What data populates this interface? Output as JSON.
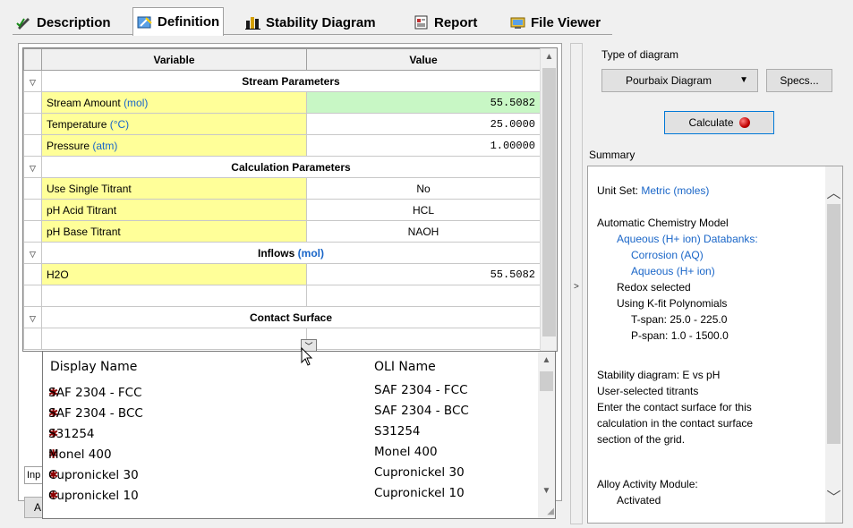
{
  "tabs": [
    {
      "label": "Description",
      "icon": "pencil-check-icon"
    },
    {
      "label": "Definition",
      "icon": "definition-icon"
    },
    {
      "label": "Stability Diagram",
      "icon": "bar-chart-icon"
    },
    {
      "label": "Report",
      "icon": "report-icon"
    },
    {
      "label": "File Viewer",
      "icon": "file-viewer-icon"
    }
  ],
  "grid": {
    "col_variable": "Variable",
    "col_value": "Value",
    "stream_section": "Stream Parameters",
    "stream_amount": {
      "label": "Stream Amount",
      "unit": "(mol)",
      "value": "55.5082"
    },
    "temperature": {
      "label": "Temperature",
      "unit": "(°C)",
      "value": "25.0000"
    },
    "pressure": {
      "label": "Pressure",
      "unit": "(atm)",
      "value": "1.00000"
    },
    "calc_section": "Calculation Parameters",
    "single_titrant": {
      "label": "Use Single Titrant",
      "value": "No"
    },
    "acid_titrant": {
      "label": "pH Acid Titrant",
      "value": "HCL"
    },
    "base_titrant": {
      "label": "pH Base Titrant",
      "value": "NAOH"
    },
    "inflows_section": "Inflows",
    "inflows_unit": "(mol)",
    "h2o": {
      "label": "H2O",
      "value": "55.5082"
    },
    "contact_section": "Contact Surface"
  },
  "dropdown": {
    "col_display": "Display Name",
    "col_oli": "OLI Name",
    "items": [
      {
        "display": "SAF 2304 - FCC",
        "oli": "SAF 2304 - FCC"
      },
      {
        "display": "SAF 2304 - BCC",
        "oli": "SAF 2304 - BCC"
      },
      {
        "display": "S31254",
        "oli": "S31254"
      },
      {
        "display": "Monel 400",
        "oli": "Monel 400"
      },
      {
        "display": "Cupronickel 30",
        "oli": "Cupronickel 30"
      },
      {
        "display": "Cupronickel 10",
        "oli": "Cupronickel 10"
      }
    ]
  },
  "hidden_bits": {
    "inp_tab": "Inp",
    "a_button": "A"
  },
  "right": {
    "type_label": "Type of diagram",
    "diagram_type": "Pourbaix Diagram",
    "specs_button": "Specs...",
    "calculate_button": "Calculate",
    "summary_label": "Summary",
    "summary": {
      "unit_set_label": "Unit Set:",
      "unit_set_value": "Metric (moles)",
      "model": "Automatic Chemistry Model",
      "databanks": "Aqueous (H+ ion) Databanks:",
      "db1": "Corrosion (AQ)",
      "db2": "Aqueous (H+ ion)",
      "redox": "Redox selected",
      "kfit": "Using K-fit Polynomials",
      "tspan": "T-span: 25.0 - 225.0",
      "pspan": "P-span: 1.0 - 1500.0",
      "stability": "Stability diagram: E vs pH",
      "user_titrants": "User-selected titrants",
      "enter1": "Enter the contact surface for this",
      "enter2": "calculation in the contact surface",
      "enter3": "section of the grid.",
      "alloy": "Alloy Activity Module:",
      "activated": "Activated"
    }
  }
}
